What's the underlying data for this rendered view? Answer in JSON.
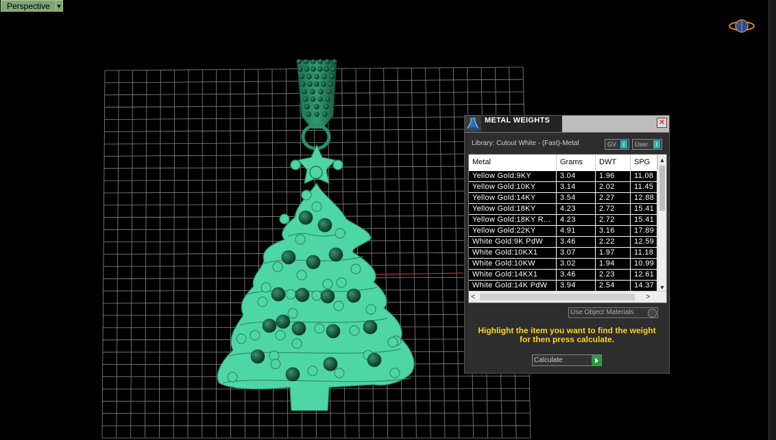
{
  "viewport": {
    "view_name": "Perspective",
    "gizmo_icon": "view-cube-icon",
    "object_color": "#4fd6a6",
    "grid_color": "#8a8a8a",
    "axis_color": "#ff3030"
  },
  "panel": {
    "title": "METAL WEIGHTS",
    "logo_icon": "flask-icon",
    "close_icon": "close-icon",
    "library_label": "Library: Cutout White - (Fast)-Metal",
    "toggle_gv": "GV",
    "toggle_user": "User",
    "toggle_indicator": "I",
    "columns": [
      "Metal",
      "Grams",
      "DWT",
      "SPG"
    ],
    "rows": [
      [
        "Yellow Gold:9KY",
        "3.04",
        "1.96",
        "11.08"
      ],
      [
        "Yellow Gold:10KY",
        "3.14",
        "2.02",
        "11.45"
      ],
      [
        "Yellow Gold:14KY",
        "3.54",
        "2.27",
        "12.88"
      ],
      [
        "Yellow Gold:18KY",
        "4.23",
        "2.72",
        "15.41"
      ],
      [
        "Yellow Gold:18KY R...",
        "4.23",
        "2.72",
        "15.41"
      ],
      [
        "Yellow Gold:22KY",
        "4.91",
        "3.16",
        "17.89"
      ],
      [
        "White Gold:9K PdW",
        "3.46",
        "2.22",
        "12.59"
      ],
      [
        "White Gold:10KX1",
        "3.07",
        "1.97",
        "11.18"
      ],
      [
        "White Gold:10KW",
        "3.02",
        "1.94",
        "10.99"
      ],
      [
        "White Gold:14KX1",
        "3.46",
        "2.23",
        "12.61"
      ],
      [
        "White Gold:14K PdW",
        "3.94",
        "2.54",
        "14.37"
      ]
    ],
    "use_object_materials": "Use Object Materials",
    "hint": "Highlight the item you want to find the weight for then press calculate.",
    "calculate_label": "Calculate"
  }
}
